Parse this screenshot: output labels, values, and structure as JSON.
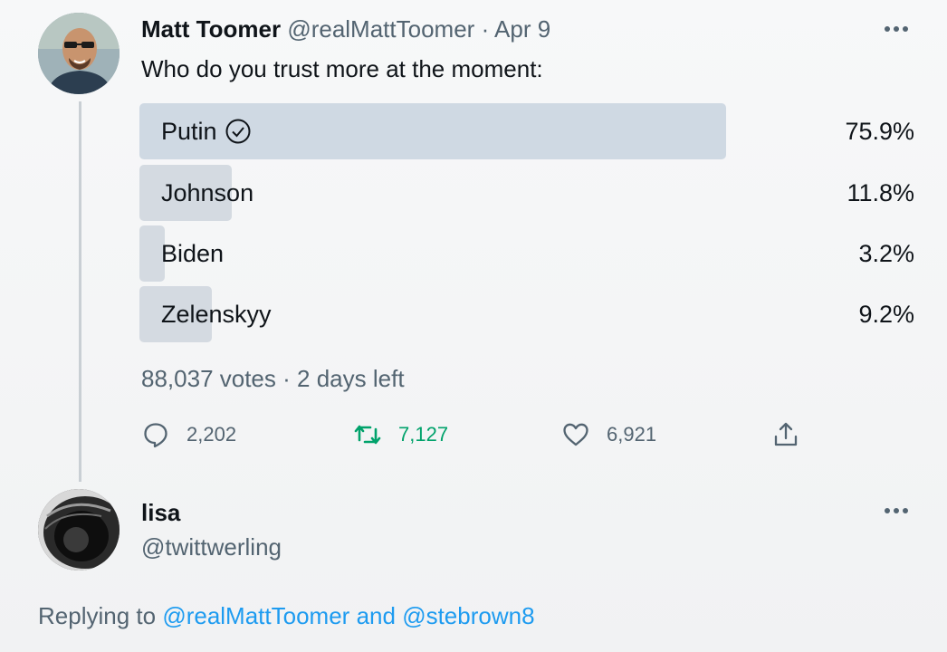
{
  "tweet": {
    "author_name": "Matt Toomer",
    "author_handle": "@realMattToomer",
    "separator": "·",
    "date": "Apr 9",
    "text": "Who do you trust more at the moment:",
    "poll": {
      "options": [
        {
          "label": "Putin",
          "percent_text": "75.9%",
          "percent": 75.9,
          "selected": true
        },
        {
          "label": "Johnson",
          "percent_text": "11.8%",
          "percent": 11.8,
          "selected": false
        },
        {
          "label": "Biden",
          "percent_text": "3.2%",
          "percent": 3.2,
          "selected": false
        },
        {
          "label": "Zelenskyy",
          "percent_text": "9.2%",
          "percent": 9.2,
          "selected": false
        }
      ],
      "votes": "88,037 votes",
      "dot": "·",
      "time_left": "2 days left"
    },
    "actions": {
      "replies": "2,202",
      "retweets": "7,127",
      "likes": "6,921"
    }
  },
  "reply": {
    "author_name": "lisa",
    "author_handle": "@twittwerling",
    "replying_prefix": "Replying to",
    "mention_1": "@realMattToomer",
    "conjunction": "and",
    "mention_2": "@stebrown8"
  },
  "colors": {
    "poll_fill": "#d4dae1",
    "retweet_green": "#00a26b",
    "secondary_text": "#536471",
    "link_blue": "#1d9bf0"
  }
}
